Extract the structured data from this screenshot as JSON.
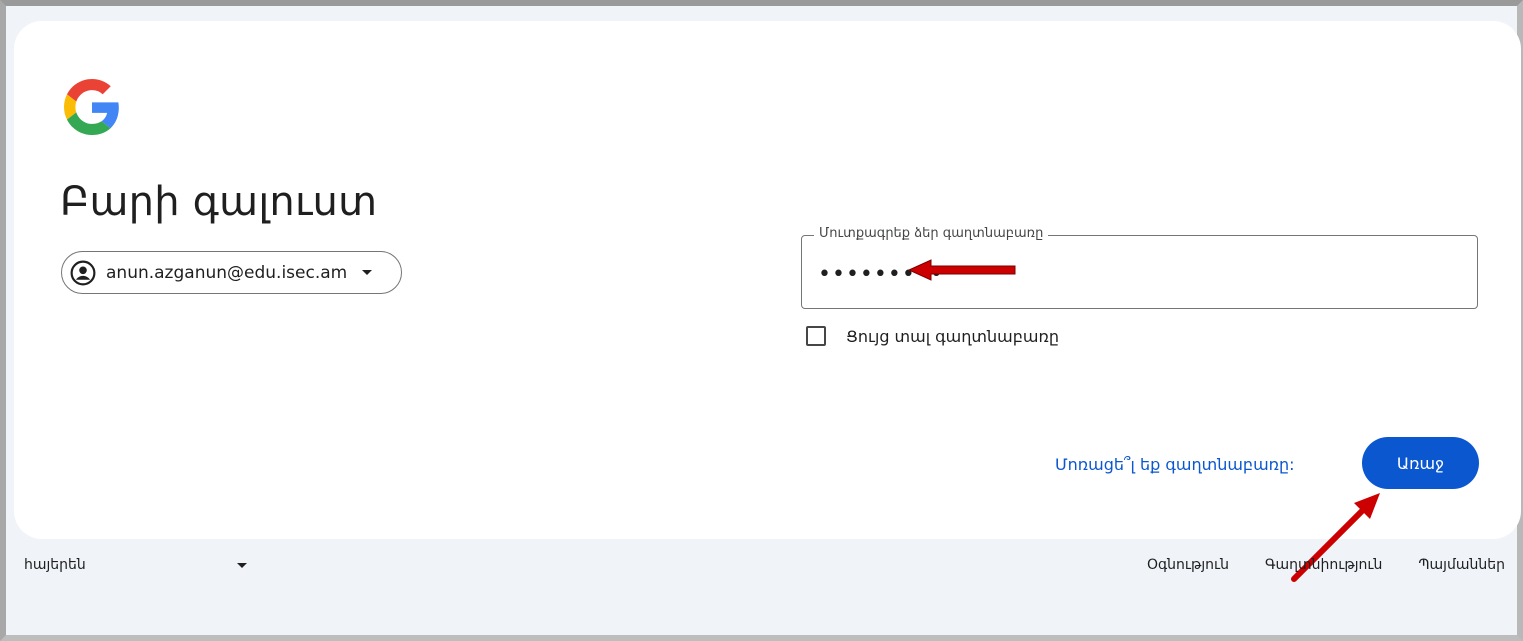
{
  "page": {
    "title": "Բարի գալուստ",
    "accent_color": "#0b57d0",
    "background_color": "#f0f4f9"
  },
  "account": {
    "email": "anun.azganun@edu.isec.am",
    "avatar_icon": "account-circle-icon",
    "chevron_icon": "chevron-down-icon"
  },
  "password": {
    "label": "Մուտքագրեք ձեր գաղտնաբառը",
    "value": "•••••••••"
  },
  "show_password": {
    "label": "Ցույց տալ գաղտնաբառը",
    "checked": false
  },
  "actions": {
    "forgot_label": "Մոռացե՞լ եք գաղտնաբառը:",
    "next_label": "Առաջ"
  },
  "footer": {
    "language": "հայերեն",
    "links": [
      "Օգնություն",
      "Գաղտնիություն",
      "Պայմաններ"
    ]
  },
  "annotations": {
    "arrow_color": "#cc0000"
  }
}
